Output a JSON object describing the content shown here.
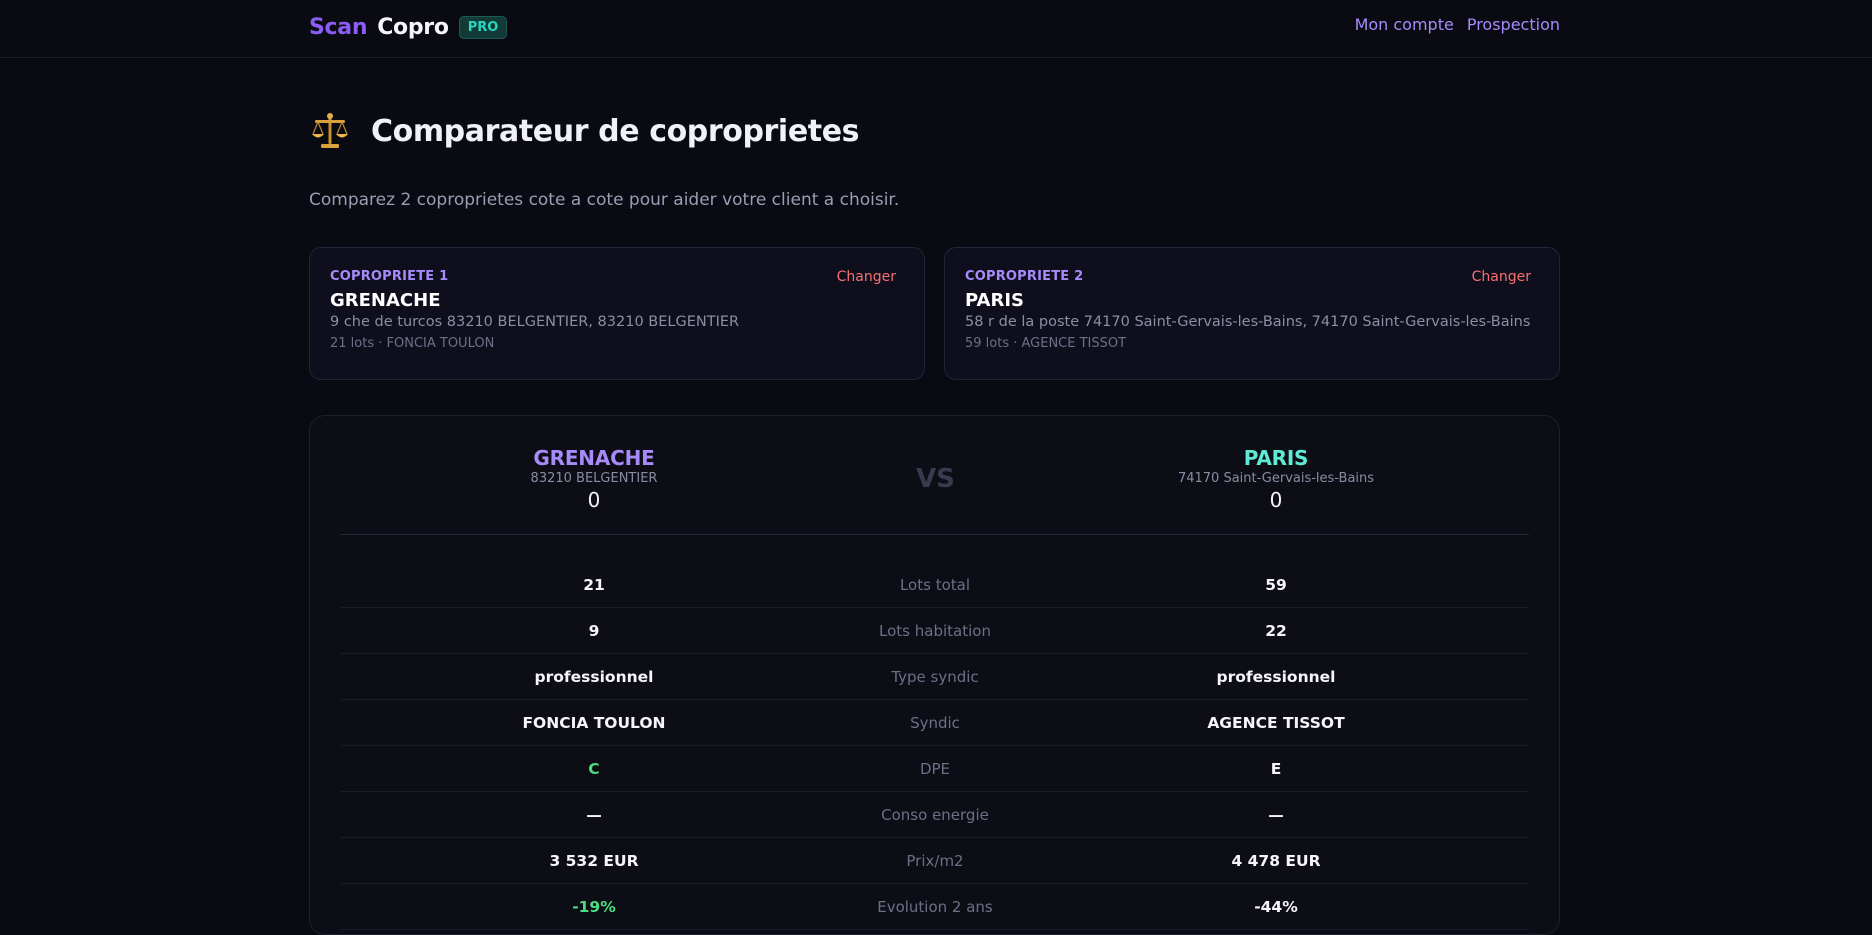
{
  "brand": {
    "scan": "Scan",
    "copro": "Copro",
    "badge": "PRO"
  },
  "nav": {
    "account": "Mon compte",
    "prospection": "Prospection"
  },
  "page": {
    "icon": "balance-scale-icon",
    "title": "Comparateur de coproprietes",
    "subtitle": "Comparez 2 coproprietes cote a cote pour aider votre client a choisir."
  },
  "cards": [
    {
      "label": "COPROPRIETE 1",
      "change": "Changer",
      "name": "GRENACHE",
      "address": "9 che de turcos 83210 BELGENTIER, 83210 BELGENTIER",
      "meta": "21 lots · FONCIA TOULON"
    },
    {
      "label": "COPROPRIETE 2",
      "change": "Changer",
      "name": "PARIS",
      "address": "58 r de la poste 74170 Saint-Gervais-les-Bains, 74170 Saint-Gervais-les-Bains",
      "meta": "59 lots · AGENCE TISSOT"
    }
  ],
  "compare": {
    "vs": "VS",
    "left": {
      "name": "GRENACHE",
      "location": "83210 BELGENTIER",
      "score": "0"
    },
    "right": {
      "name": "PARIS",
      "location": "74170 Saint-Gervais-les-Bains",
      "score": "0"
    },
    "rows": [
      {
        "label": "Lots total",
        "left": "21",
        "right": "59"
      },
      {
        "label": "Lots habitation",
        "left": "9",
        "right": "22"
      },
      {
        "label": "Type syndic",
        "left": "professionnel",
        "right": "professionnel"
      },
      {
        "label": "Syndic",
        "left": "FONCIA TOULON",
        "right": "AGENCE TISSOT"
      },
      {
        "label": "DPE",
        "left": "C",
        "right": "E"
      },
      {
        "label": "Conso energie",
        "left": "—",
        "right": "—"
      },
      {
        "label": "Prix/m2",
        "left": "3 532 EUR",
        "right": "4 478 EUR"
      },
      {
        "label": "Evolution 2 ans",
        "left": "-19%",
        "right": "-44%"
      }
    ]
  },
  "colors": {
    "accent_purple": "#8b5cf6",
    "accent_teal": "#2dd4bf",
    "danger": "#f87171",
    "good": "#4ade80"
  }
}
